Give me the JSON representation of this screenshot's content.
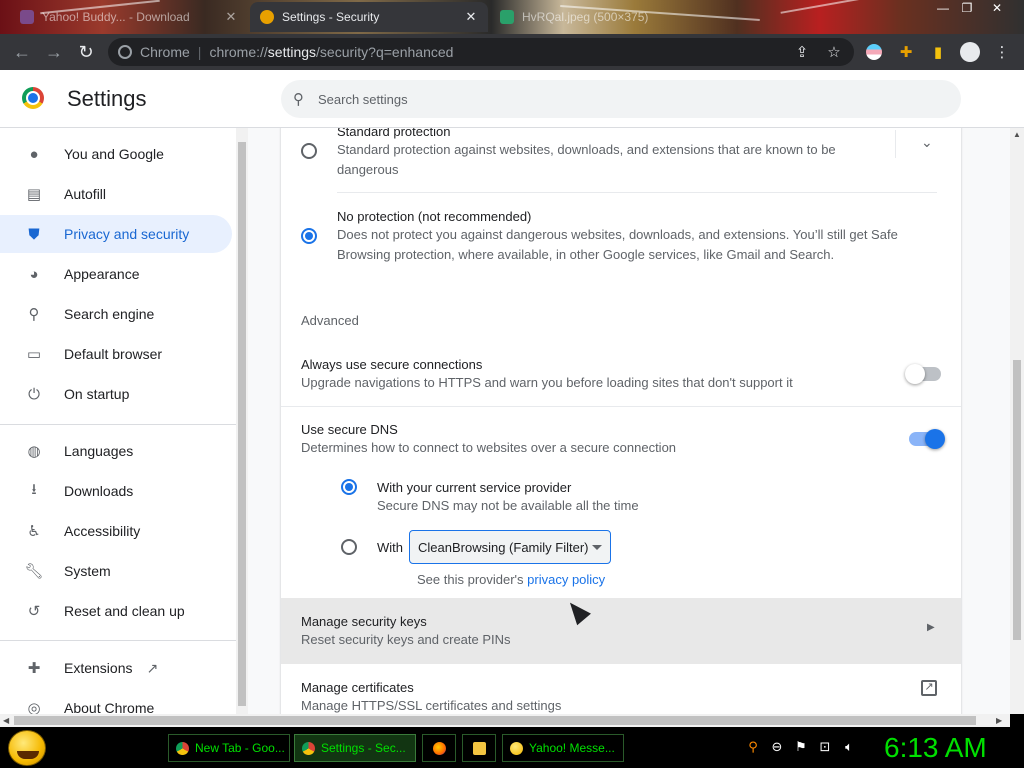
{
  "browser": {
    "tabs": [
      {
        "title": "Yahoo! Buddy... - Download",
        "active": false
      },
      {
        "title": "Settings - Security",
        "active": true
      },
      {
        "title": "HvRQal.jpeg (500×375)",
        "active": false
      }
    ],
    "address": {
      "scheme_label": "Chrome",
      "prefix": "chrome://",
      "host": "settings",
      "path": "/security?q=enhanced"
    }
  },
  "header": {
    "title": "Settings",
    "search_placeholder": "Search settings"
  },
  "sidebar": {
    "items": [
      {
        "label": "You and Google",
        "icon": "person-icon"
      },
      {
        "label": "Autofill",
        "icon": "clipboard-icon"
      },
      {
        "label": "Privacy and security",
        "icon": "shield-icon",
        "selected": true
      },
      {
        "label": "Appearance",
        "icon": "palette-icon"
      },
      {
        "label": "Search engine",
        "icon": "search-icon"
      },
      {
        "label": "Default browser",
        "icon": "browser-window-icon"
      },
      {
        "label": "On startup",
        "icon": "power-icon"
      },
      {
        "label": "Languages",
        "icon": "globe-icon"
      },
      {
        "label": "Downloads",
        "icon": "download-icon"
      },
      {
        "label": "Accessibility",
        "icon": "accessibility-icon"
      },
      {
        "label": "System",
        "icon": "wrench-icon"
      },
      {
        "label": "Reset and clean up",
        "icon": "restore-icon"
      },
      {
        "label": "Extensions",
        "icon": "puzzle-icon"
      },
      {
        "label": "About Chrome",
        "icon": "chrome-icon"
      }
    ]
  },
  "security": {
    "standard": {
      "title": "Standard protection",
      "desc_line1": "Standard protection against websites, downloads, and extensions that are known to be",
      "desc_line2": "dangerous"
    },
    "none": {
      "title": "No protection (not recommended)",
      "desc_line1": "Does not protect you against dangerous websites, downloads, and extensions. You’ll still get Safe",
      "desc_line2": "Browsing protection, where available, in other Google services, like Gmail and Search."
    },
    "advanced_heading": "Advanced",
    "https_only": {
      "title": "Always use secure connections",
      "desc": "Upgrade navigations to HTTPS and warn you before loading sites that don't support it",
      "enabled": false
    },
    "secure_dns": {
      "title": "Use secure DNS",
      "desc": "Determines how to connect to websites over a secure connection",
      "enabled": true,
      "current_provider_title": "With your current service provider",
      "current_provider_desc": "Secure DNS may not be available all the time",
      "with_label": "With",
      "provider_selected": "CleanBrowsing (Family Filter)",
      "policy_prefix": "See this provider's ",
      "policy_link": "privacy policy"
    },
    "security_keys": {
      "title": "Manage security keys",
      "desc": "Reset security keys and create PINs"
    },
    "certificates": {
      "title": "Manage certificates",
      "desc": "Manage HTTPS/SSL certificates and settings"
    }
  },
  "taskbar": {
    "tasks": [
      {
        "label": "New Tab - Goo...",
        "icon": "chrome-icon"
      },
      {
        "label": "Settings - Sec...",
        "icon": "chrome-icon",
        "active": true
      },
      {
        "label": "",
        "icon": "firefox-icon"
      },
      {
        "label": "",
        "icon": "folder-icon"
      },
      {
        "label": "Yahoo! Messe...",
        "icon": "yahoo-messenger-icon"
      }
    ],
    "clock": "6:13 AM"
  },
  "colors": {
    "accent": "#1a73e8",
    "selected_nav_bg": "#e8f0fe",
    "taskbar_text": "#00e000"
  }
}
